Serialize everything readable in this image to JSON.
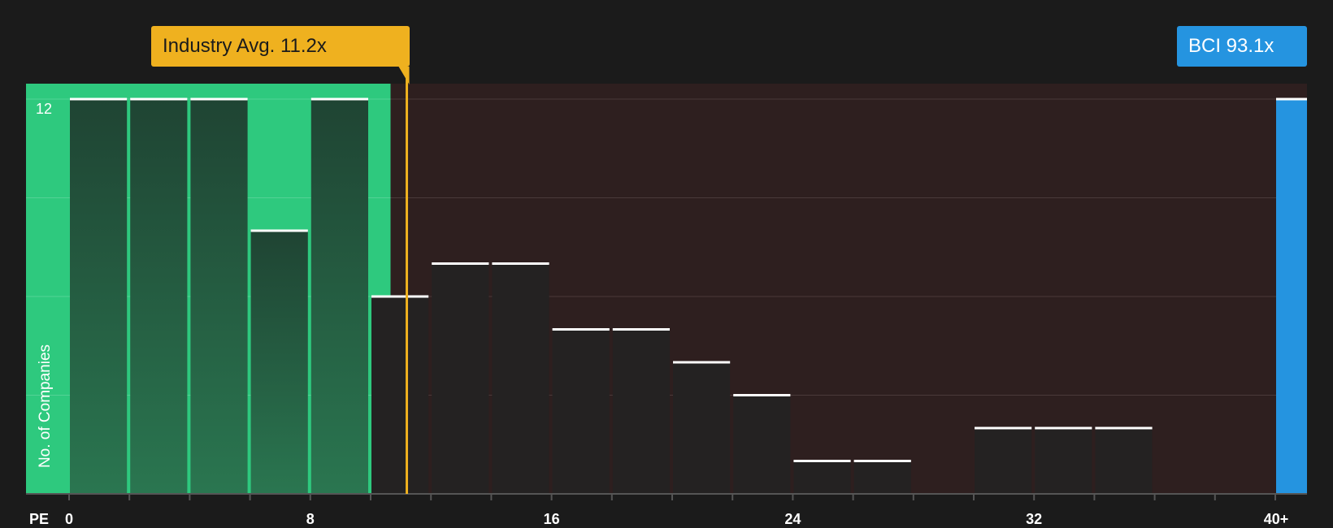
{
  "chart_data": {
    "type": "bar",
    "metric": "PE",
    "xlabel": "PE",
    "ylabel": "No. of Companies",
    "x_ticks": [
      "0",
      "8",
      "16",
      "24",
      "32",
      "40+"
    ],
    "x_tick_values": [
      0,
      8,
      16,
      24,
      32,
      40
    ],
    "y_tick_labels": [
      "12"
    ],
    "y_max": 12,
    "ylim": [
      0,
      12
    ],
    "bin_width": 2,
    "bins": [
      {
        "from": 0,
        "to": 2,
        "value": 12
      },
      {
        "from": 2,
        "to": 4,
        "value": 12
      },
      {
        "from": 4,
        "to": 6,
        "value": 12
      },
      {
        "from": 6,
        "to": 8,
        "value": 8
      },
      {
        "from": 8,
        "to": 10,
        "value": 12
      },
      {
        "from": 10,
        "to": 12,
        "value": 6
      },
      {
        "from": 12,
        "to": 14,
        "value": 7
      },
      {
        "from": 14,
        "to": 16,
        "value": 7
      },
      {
        "from": 16,
        "to": 18,
        "value": 5
      },
      {
        "from": 18,
        "to": 20,
        "value": 5
      },
      {
        "from": 20,
        "to": 22,
        "value": 4
      },
      {
        "from": 22,
        "to": 24,
        "value": 3
      },
      {
        "from": 24,
        "to": 26,
        "value": 1
      },
      {
        "from": 26,
        "to": 28,
        "value": 1
      },
      {
        "from": 28,
        "to": 30,
        "value": 0
      },
      {
        "from": 30,
        "to": 32,
        "value": 2
      },
      {
        "from": 32,
        "to": 34,
        "value": 2
      },
      {
        "from": 34,
        "to": 36,
        "value": 2
      },
      {
        "from": 36,
        "to": 38,
        "value": 0
      },
      {
        "from": 38,
        "to": 40,
        "value": 0
      },
      {
        "from": 40,
        "to": 41,
        "value": 12,
        "label": "40+",
        "highlight": true
      }
    ],
    "industry_avg": {
      "value": 11.2,
      "label": "Industry Avg. 11.2x"
    },
    "company": {
      "name": "BCI",
      "value": 93.1,
      "label": "BCI 93.1x"
    },
    "undervalued_range": [
      0,
      11.2
    ],
    "grid": true,
    "colors": {
      "background": "#1b1b1b",
      "undervalued_zone": "#2ec97e",
      "overvalued_zone": "#2e1f1f",
      "bar_in_green_zone": "#22583d",
      "bar_dark": "#242222",
      "bar_top_line": "#ffffff",
      "industry_avg": "#efb11f",
      "company_bar": "#2594e0",
      "gridline": "#4a3a3a",
      "axis": "#555555"
    }
  }
}
